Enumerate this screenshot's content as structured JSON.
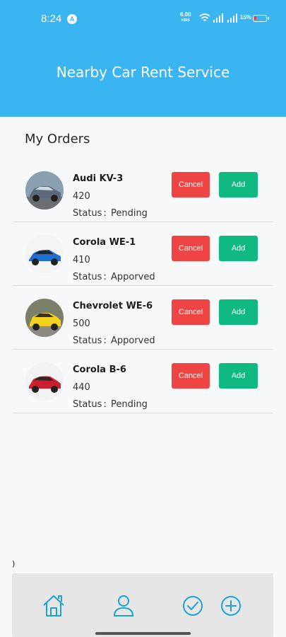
{
  "status_bar": {
    "time": "8:24",
    "app_badge": "A",
    "net_speed": "6.00",
    "net_unit": "KB/S",
    "battery_pct": "15%"
  },
  "app_bar": {
    "title": "Nearby Car Rent Service"
  },
  "orders_section": {
    "title": "My Orders",
    "status_label": "Status",
    "items": [
      {
        "name": "Audi KV-3",
        "price": "420",
        "status": "Pending",
        "cancel_label": "Cancel",
        "add_label": "Add",
        "car_color": "#5b6b7d"
      },
      {
        "name": "Corola WE-1",
        "price": "410",
        "status": "Apporved",
        "cancel_label": "Cancel",
        "add_label": "Add",
        "car_color": "#1f6fd1"
      },
      {
        "name": "Chevrolet WE-6",
        "price": "500",
        "status": "Apporved",
        "cancel_label": "Cancel",
        "add_label": "Add",
        "car_color": "#f2d21c"
      },
      {
        "name": "Corola B-6",
        "price": "440",
        "status": "Pending",
        "cancel_label": "Cancel",
        "add_label": "Add",
        "car_color": "#c8212b"
      }
    ]
  },
  "stray_text": ")",
  "bottom_nav": {
    "icons": [
      "home-icon",
      "profile-icon",
      "check-circle-icon",
      "add-circle-icon"
    ],
    "accent": "#1aa3d1"
  },
  "colors": {
    "primary": "#3bb4f2",
    "cancel": "#ef4444",
    "add": "#10b981"
  }
}
